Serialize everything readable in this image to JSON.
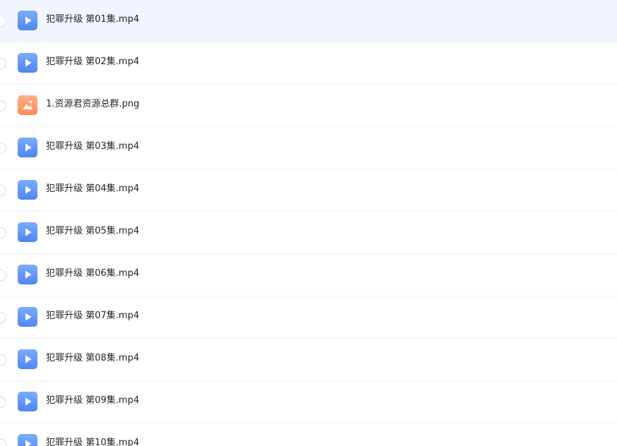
{
  "files": [
    {
      "name": "犯罪升级 第01集.mp4",
      "icon": "video-file-icon",
      "type": "video",
      "selected": true
    },
    {
      "name": "犯罪升级 第02集.mp4",
      "icon": "video-file-icon",
      "type": "video"
    },
    {
      "name": "1.资源君资源总群.png",
      "icon": "image-file-icon",
      "type": "image"
    },
    {
      "name": "犯罪升级 第03集.mp4",
      "icon": "video-file-icon",
      "type": "video"
    },
    {
      "name": "犯罪升级 第04集.mp4",
      "icon": "video-file-icon",
      "type": "video"
    },
    {
      "name": "犯罪升级 第05集.mp4",
      "icon": "video-file-icon",
      "type": "video"
    },
    {
      "name": "犯罪升级 第06集.mp4",
      "icon": "video-file-icon",
      "type": "video"
    },
    {
      "name": "犯罪升级 第07集.mp4",
      "icon": "video-file-icon",
      "type": "video"
    },
    {
      "name": "犯罪升级 第08集.mp4",
      "icon": "video-file-icon",
      "type": "video"
    },
    {
      "name": "犯罪升级 第09集.mp4",
      "icon": "video-file-icon",
      "type": "video"
    },
    {
      "name": "犯罪升级 第10集.mp4",
      "icon": "video-file-icon",
      "type": "video"
    }
  ],
  "colors": {
    "selected_row_bg": "#f1f6fe",
    "video_icon": "#5b8ff9",
    "image_icon": "#ff9563",
    "text": "#1f2329",
    "divider": "#eef0f3"
  }
}
